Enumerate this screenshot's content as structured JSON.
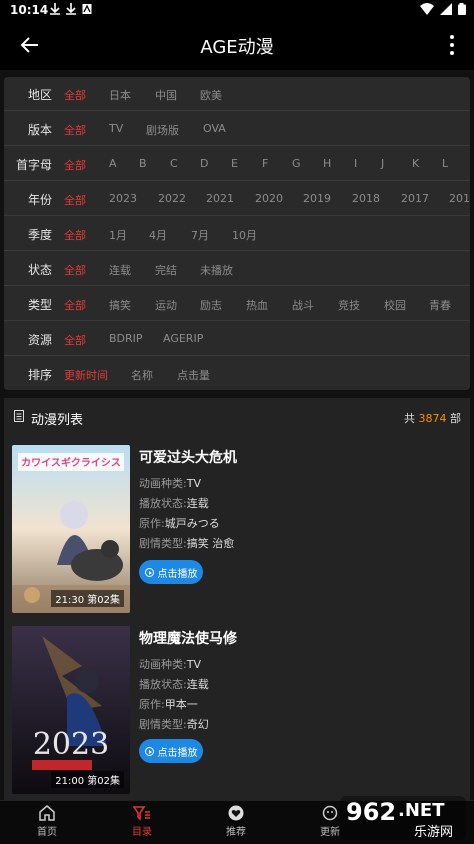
{
  "status": {
    "time": "10:14"
  },
  "app": {
    "title": "AGE动漫"
  },
  "filters": [
    {
      "label": "地区",
      "options": [
        "全部",
        "日本",
        "中国",
        "欧美"
      ],
      "active": 0
    },
    {
      "label": "版本",
      "options": [
        "全部",
        "TV",
        "剧场版",
        "OVA"
      ],
      "active": 0
    },
    {
      "label": "首字母",
      "options": [
        "全部",
        "A",
        "B",
        "C",
        "D",
        "E",
        "F",
        "G",
        "H",
        "I",
        "J",
        "K",
        "L"
      ],
      "active": 0
    },
    {
      "label": "年份",
      "options": [
        "全部",
        "2023",
        "2022",
        "2021",
        "2020",
        "2019",
        "2018",
        "2017",
        "2016"
      ],
      "active": 0
    },
    {
      "label": "季度",
      "options": [
        "全部",
        "1月",
        "4月",
        "7月",
        "10月"
      ],
      "active": 0
    },
    {
      "label": "状态",
      "options": [
        "全部",
        "连载",
        "完结",
        "未播放"
      ],
      "active": 0
    },
    {
      "label": "类型",
      "options": [
        "全部",
        "搞笑",
        "运动",
        "励志",
        "热血",
        "战斗",
        "竞技",
        "校园",
        "青春"
      ],
      "active": 0
    },
    {
      "label": "资源",
      "options": [
        "全部",
        "BDRIP",
        "AGERIP"
      ],
      "active": 0
    },
    {
      "label": "排序",
      "options": [
        "更新时间",
        "名称",
        "点击量"
      ],
      "active": 0
    }
  ],
  "list": {
    "title": "动漫列表",
    "count_prefix": "共",
    "count": "3874",
    "count_suffix": "部",
    "items": [
      {
        "title": "可爱过头大危机",
        "poster_title": "カワイスギクライシス",
        "episode": "21:30 第02集",
        "fields": [
          {
            "k": "动画种类:",
            "v": "TV"
          },
          {
            "k": "播放状态:",
            "v": "连载"
          },
          {
            "k": "原作:",
            "v": "城戸みつる"
          },
          {
            "k": "剧情类型:",
            "v": "搞笑 治愈"
          }
        ],
        "play": "点击播放"
      },
      {
        "title": "物理魔法使马修",
        "poster_title": "2023",
        "episode": "21:00 第02集",
        "fields": [
          {
            "k": "动画种类:",
            "v": "TV"
          },
          {
            "k": "播放状态:",
            "v": "连载"
          },
          {
            "k": "原作:",
            "v": "甲本一"
          },
          {
            "k": "剧情类型:",
            "v": "奇幻"
          }
        ],
        "play": "点击播放"
      }
    ]
  },
  "nav": [
    {
      "label": "首页",
      "icon": "home-icon"
    },
    {
      "label": "目录",
      "icon": "filter-list-icon"
    },
    {
      "label": "推荐",
      "icon": "heart-icon"
    },
    {
      "label": "更新",
      "icon": "update-icon"
    }
  ],
  "nav_active": 1,
  "watermark": {
    "text": "962",
    "suffix": ".NET",
    "sub": "乐游网"
  },
  "colors": {
    "accent": "#e53935",
    "count": "#ff8a00",
    "play": "#1e88e5"
  }
}
